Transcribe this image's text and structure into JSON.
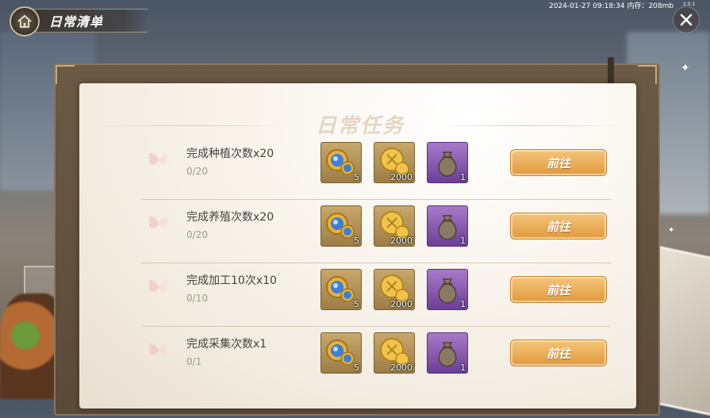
{
  "header": {
    "title": "日常清单",
    "status": "2024-01-27 09:18:34 内存：208mb",
    "version": "2.0.1"
  },
  "panel": {
    "title": "日常任务"
  },
  "tasks": [
    {
      "title": "完成种植次数x20",
      "progress": "0/20",
      "rewards": [
        "5",
        "2000",
        "1"
      ],
      "button": "前往"
    },
    {
      "title": "完成养殖次数x20",
      "progress": "0/20",
      "rewards": [
        "5",
        "2000",
        "1"
      ],
      "button": "前往"
    },
    {
      "title": "完成加工10次x10",
      "progress": "0/10",
      "rewards": [
        "5",
        "2000",
        "1"
      ],
      "button": "前往"
    },
    {
      "title": "完成采集次数x1",
      "progress": "0/1",
      "rewards": [
        "5",
        "2000",
        "1"
      ],
      "button": "前往"
    }
  ],
  "icons": {
    "home": "home-icon",
    "close": "close-icon",
    "reward_1": "blue-gem-coin-icon",
    "reward_2": "gold-coin-icon",
    "reward_3": "sack-icon",
    "row_marker": "butterfly-icon"
  },
  "colors": {
    "button": "#e9a94d",
    "gold_slot": "#b8945a",
    "purple_slot": "#8a5bb0",
    "text": "#4b4036"
  }
}
